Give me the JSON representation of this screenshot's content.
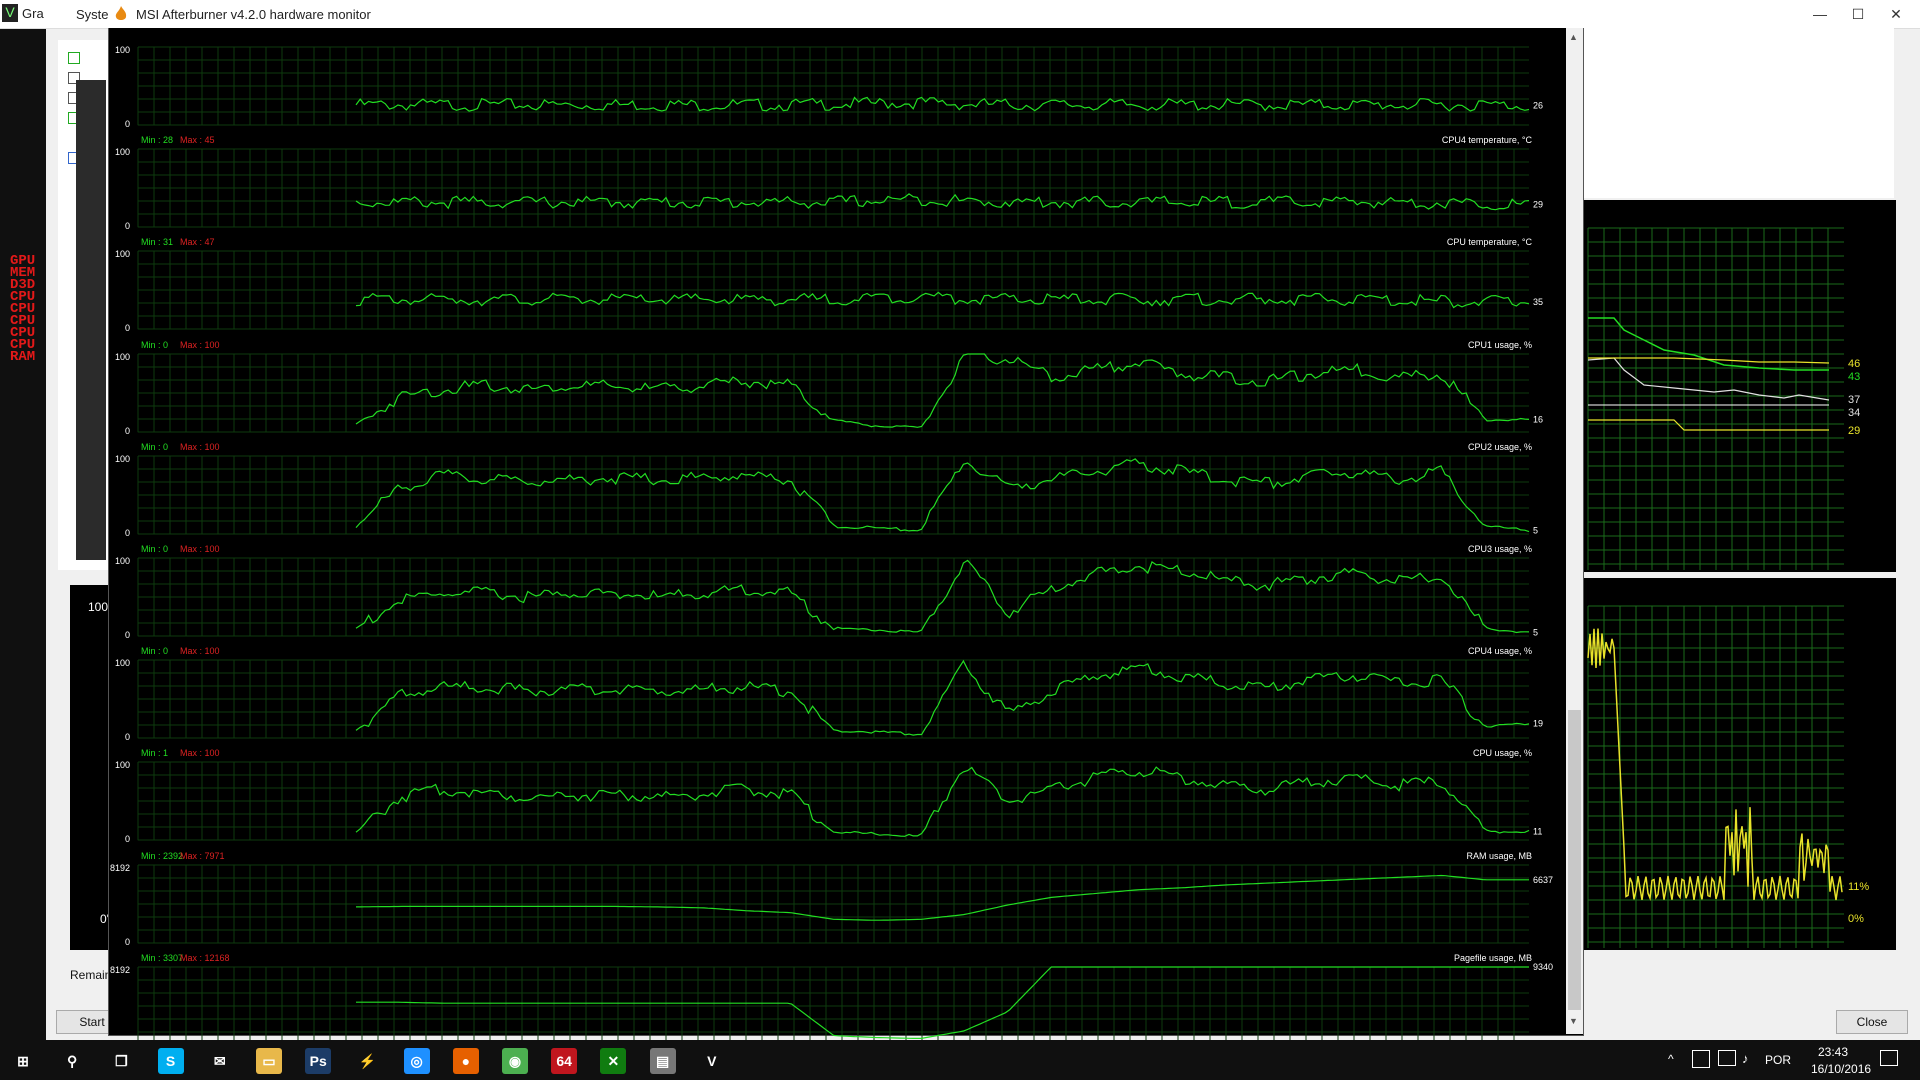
{
  "background_window": {
    "title": "Gra",
    "title2": "Syste",
    "osd_labels": [
      "GPU",
      "MEM",
      "D3D",
      "CPU",
      "CPU",
      "CPU",
      "CPU",
      "CPU",
      "RAM"
    ],
    "pct_label": "100'",
    "zero_label": "0'",
    "remain_label": "Remain",
    "start_label": "Start",
    "close_label": "Close",
    "minimize_glyph": "—",
    "maximize_glyph": "☐",
    "close_glyph": "✕",
    "side_graph_top_labels": [
      "46",
      "43",
      "37",
      "34",
      "29"
    ],
    "side_graph_bottom_labels": [
      "11%",
      "0%"
    ]
  },
  "window": {
    "title": "MSI Afterburner v4.2.0 hardware monitor",
    "scroll_up": "▲",
    "scroll_down": "▼"
  },
  "graphs": [
    {
      "name": "",
      "min": "",
      "max": "",
      "top": "100",
      "bottom": "0",
      "current": "26",
      "color": "#22dd22"
    },
    {
      "name": "CPU4 temperature, °C",
      "min": "Min : 28",
      "max": "Max : 45",
      "top": "100",
      "bottom": "0",
      "current": "29",
      "color": "#22dd22"
    },
    {
      "name": "CPU temperature, °C",
      "min": "Min : 31",
      "max": "Max : 47",
      "top": "100",
      "bottom": "0",
      "current": "35",
      "color": "#22dd22"
    },
    {
      "name": "CPU1 usage, %",
      "min": "Min : 0",
      "max": "Max : 100",
      "top": "100",
      "bottom": "0",
      "current": "16",
      "color": "#22dd22"
    },
    {
      "name": "CPU2 usage, %",
      "min": "Min : 0",
      "max": "Max : 100",
      "top": "100",
      "bottom": "0",
      "current": "5",
      "color": "#22dd22"
    },
    {
      "name": "CPU3 usage, %",
      "min": "Min : 0",
      "max": "Max : 100",
      "top": "100",
      "bottom": "0",
      "current": "5",
      "color": "#22dd22"
    },
    {
      "name": "CPU4 usage, %",
      "min": "Min : 0",
      "max": "Max : 100",
      "top": "100",
      "bottom": "0",
      "current": "19",
      "color": "#22dd22"
    },
    {
      "name": "CPU usage, %",
      "min": "Min : 1",
      "max": "Max : 100",
      "top": "100",
      "bottom": "0",
      "current": "11",
      "color": "#22dd22"
    },
    {
      "name": "RAM usage, MB",
      "min": "Min : 2392",
      "max": "Max : 7971",
      "top": "8192",
      "bottom": "0",
      "current": "6637",
      "color": "#22dd22"
    },
    {
      "name": "Pagefile usage, MB",
      "min": "Min : 3307",
      "max": "Max : 12168",
      "top": "8192",
      "bottom": "0",
      "current": "9340",
      "color": "#22dd22"
    }
  ],
  "chart_data": {
    "type": "line",
    "title": "MSI Afterburner v4.2.0 hardware monitor",
    "series": [
      {
        "name": "",
        "values": [
          26,
          26,
          26,
          26,
          26,
          26,
          26,
          26,
          26,
          26,
          26,
          27,
          28,
          29,
          27,
          26,
          26,
          26,
          26,
          26,
          26,
          26,
          26,
          26,
          26,
          26,
          26,
          25
        ]
      },
      {
        "name": "CPU4 temperature, °C",
        "values": [
          32,
          32,
          32,
          32,
          32,
          32,
          32,
          32,
          32,
          32,
          32,
          32,
          34,
          36,
          33,
          32,
          32,
          32,
          32,
          32,
          32,
          32,
          32,
          32,
          32,
          31,
          30,
          29
        ]
      },
      {
        "name": "CPU temperature, °C",
        "values": [
          38,
          38,
          38,
          38,
          38,
          38,
          38,
          38,
          38,
          38,
          38,
          38,
          40,
          42,
          39,
          38,
          38,
          38,
          38,
          38,
          38,
          38,
          38,
          38,
          37,
          36,
          35,
          35
        ]
      },
      {
        "name": "CPU1 usage, %",
        "values": [
          10,
          45,
          55,
          60,
          55,
          60,
          58,
          55,
          60,
          65,
          60,
          15,
          8,
          5,
          95,
          95,
          70,
          80,
          90,
          75,
          70,
          65,
          75,
          80,
          70,
          75,
          16,
          16
        ]
      },
      {
        "name": "CPU2 usage, %",
        "values": [
          10,
          60,
          75,
          70,
          68,
          70,
          72,
          70,
          73,
          75,
          70,
          10,
          8,
          5,
          95,
          60,
          70,
          80,
          90,
          80,
          70,
          65,
          75,
          80,
          70,
          80,
          10,
          5
        ]
      },
      {
        "name": "CPU3 usage, %",
        "values": [
          10,
          45,
          55,
          55,
          50,
          55,
          55,
          50,
          55,
          60,
          55,
          10,
          8,
          5,
          95,
          30,
          60,
          80,
          90,
          85,
          70,
          65,
          75,
          80,
          70,
          75,
          10,
          5
        ]
      },
      {
        "name": "CPU4 usage, %",
        "values": [
          10,
          55,
          65,
          65,
          60,
          62,
          62,
          60,
          63,
          65,
          60,
          10,
          8,
          5,
          95,
          30,
          60,
          80,
          90,
          80,
          70,
          65,
          75,
          80,
          70,
          75,
          15,
          19
        ]
      },
      {
        "name": "CPU usage, %",
        "values": [
          10,
          55,
          65,
          60,
          55,
          58,
          58,
          55,
          60,
          65,
          60,
          10,
          8,
          5,
          95,
          50,
          65,
          80,
          90,
          80,
          70,
          65,
          75,
          80,
          70,
          75,
          11,
          11
        ]
      },
      {
        "name": "RAM usage, MB",
        "values": [
          3800,
          3850,
          3850,
          3850,
          3850,
          3850,
          3850,
          3800,
          3700,
          3400,
          3200,
          2500,
          2400,
          2500,
          3000,
          4000,
          4800,
          5200,
          5600,
          5800,
          6100,
          6300,
          6500,
          6700,
          6900,
          7100,
          6637,
          6637
        ]
      },
      {
        "name": "Pagefile usage, MB",
        "values": [
          4500,
          4500,
          4400,
          4400,
          4400,
          4400,
          4400,
          4400,
          4400,
          4400,
          4400,
          1000,
          800,
          700,
          1500,
          3500,
          8192,
          8192,
          8192,
          8192,
          8192,
          8192,
          8192,
          8192,
          8192,
          8192,
          8192,
          8192
        ]
      }
    ]
  },
  "taskbar": {
    "icons": [
      {
        "name": "start",
        "glyph": "⊞",
        "color": "#101010"
      },
      {
        "name": "search",
        "glyph": "⚲",
        "color": "#101010"
      },
      {
        "name": "task-view",
        "glyph": "❐",
        "color": "#101010"
      },
      {
        "name": "skype",
        "glyph": "S",
        "color": "#00aff0"
      },
      {
        "name": "mail",
        "glyph": "✉",
        "color": "#101010"
      },
      {
        "name": "explorer",
        "glyph": "▭",
        "color": "#e8b84a"
      },
      {
        "name": "photoshop",
        "glyph": "Ps",
        "color": "#1c3c67"
      },
      {
        "name": "afterburner",
        "glyph": "⚡",
        "color": "#101010"
      },
      {
        "name": "app",
        "glyph": "◎",
        "color": "#1e90ff"
      },
      {
        "name": "firefox",
        "glyph": "●",
        "color": "#e66000"
      },
      {
        "name": "chrome",
        "glyph": "◉",
        "color": "#4caf50"
      },
      {
        "name": "aida64",
        "glyph": "64",
        "color": "#c0161e"
      },
      {
        "name": "xbox",
        "glyph": "✕",
        "color": "#107c10"
      },
      {
        "name": "printer",
        "glyph": "▤",
        "color": "#777"
      },
      {
        "name": "gpu-z",
        "glyph": "V",
        "color": "#101010"
      }
    ],
    "language": "POR",
    "time": "23:43",
    "date": "16/10/2016"
  }
}
